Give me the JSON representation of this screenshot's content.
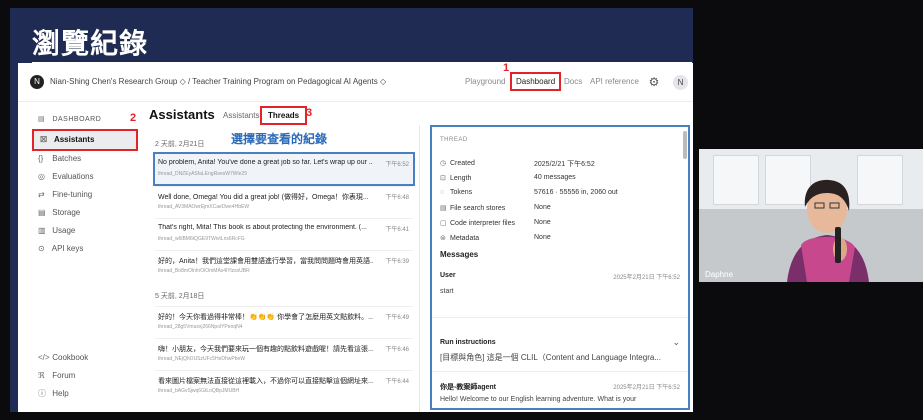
{
  "slide": {
    "title": "瀏覽紀錄"
  },
  "header": {
    "org_initial": "N",
    "org": "Nian-Shing Chen's Research Group ◇ / Teacher Training Program on Pedagogical AI Agents ◇",
    "nav": [
      {
        "label": "Playground"
      },
      {
        "label": "Dashboard"
      },
      {
        "label": "Docs"
      },
      {
        "label": "API reference"
      }
    ],
    "settings_icon": "⚙",
    "user_initial": "N"
  },
  "marks": {
    "m1": "1",
    "m2": "2",
    "m3": "3"
  },
  "sidebar": {
    "top": {
      "label": "DASHBOARD",
      "icon": "▤"
    },
    "items": [
      {
        "label": "Assistants",
        "icon": "☒"
      },
      {
        "label": "Batches",
        "icon": "{}"
      },
      {
        "label": "Evaluations",
        "icon": "◎"
      },
      {
        "label": "Fine-tuning",
        "icon": "⇄"
      },
      {
        "label": "Storage",
        "icon": "▤"
      },
      {
        "label": "Usage",
        "icon": "▥"
      },
      {
        "label": "API keys",
        "icon": "⊙"
      }
    ],
    "bottom": [
      {
        "label": "Cookbook",
        "icon": "</>"
      },
      {
        "label": "Forum",
        "icon": "ℜ"
      },
      {
        "label": "Help",
        "icon": "ⓘ"
      }
    ]
  },
  "main": {
    "title": "Assistants",
    "tabs": [
      {
        "label": "Assistants"
      },
      {
        "label": "Threads"
      }
    ],
    "select_label": "選擇要查看的紀錄",
    "sections": [
      "2 天前, 2月21日",
      "5 天前, 2月18日"
    ],
    "rows": [
      {
        "title": "No problem, Anita! You've done a great job so far. Let's wrap up our ...",
        "id": "thread_DNZEyASfaLEngReesW7Wle29",
        "time": "下午6:52"
      },
      {
        "title": "Well done, Omega! You did a great job! (做得好，Omega！你表現...",
        "id": "thread_AV3MAOwrEjmXCaeDwe4HbEW",
        "time": "下午6:48"
      },
      {
        "title": "That's right, Mita! This book is about protecting the environment. (...",
        "id": "thread_w6lBM6tQGE9TWivtLns6RcFG",
        "time": "下午6:41"
      },
      {
        "title": "好的，Anita！我們這堂課會用雙語進行學習，當我問問題時會用英語...",
        "id": "thread_Bo8mOlnhrOiOmMAs4lYlzsxUBR",
        "time": "下午6:39"
      },
      {
        "title": "好的！今天你看過得非常棒！👏👏👏 你學會了怎麼用英文點飲料。...",
        "id": "thread_28g5Vmuxxj266NpolYPeoqN4",
        "time": "下午6:49"
      },
      {
        "title": "嗨！小朋友，今天我們要來玩一個有趣的點飲料遊戲喔！請先看這張...",
        "id": "thread_NEjQhOUSzUFc5HeDhwPbeW",
        "time": "下午6:46"
      },
      {
        "title": "看來圖片檔案無法直接從這裡載入，不過你可以直接點擊這個網址來...",
        "id": "thread_bAGvSjwq6GtLoQBpJMUBH",
        "time": "下午6:44"
      }
    ]
  },
  "thread": {
    "caption": "THREAD",
    "props": [
      {
        "icon": "◷",
        "label": "Created",
        "value": "2025/2/21 下午6:52"
      },
      {
        "icon": "⊡",
        "label": "Length",
        "value": "40 messages"
      },
      {
        "icon": "◌",
        "label": "Tokens",
        "value": "57616 · 55556 in, 2060 out"
      },
      {
        "icon": "▤",
        "label": "File search stores",
        "value": "None"
      },
      {
        "icon": "▢",
        "label": "Code interpreter files",
        "value": "None"
      },
      {
        "icon": "⊜",
        "label": "Metadata",
        "value": "None"
      }
    ],
    "messages_label": "Messages",
    "messages": [
      {
        "role": "User",
        "time": "2025年2月21日 下午6:52",
        "text": "start"
      }
    ],
    "run_label": "Run instructions",
    "run_chevron": "⌄",
    "run_text": "[目標與角色] 這是一個 CLIL（Content and Language Integra...",
    "agent_role": "你是-教案師agent",
    "agent_time": "2025年2月21日 下午6:52",
    "agent_text": "Hello! Welcome to our English learning adventure. What is your"
  },
  "webcam": {
    "name": "Daphne"
  }
}
